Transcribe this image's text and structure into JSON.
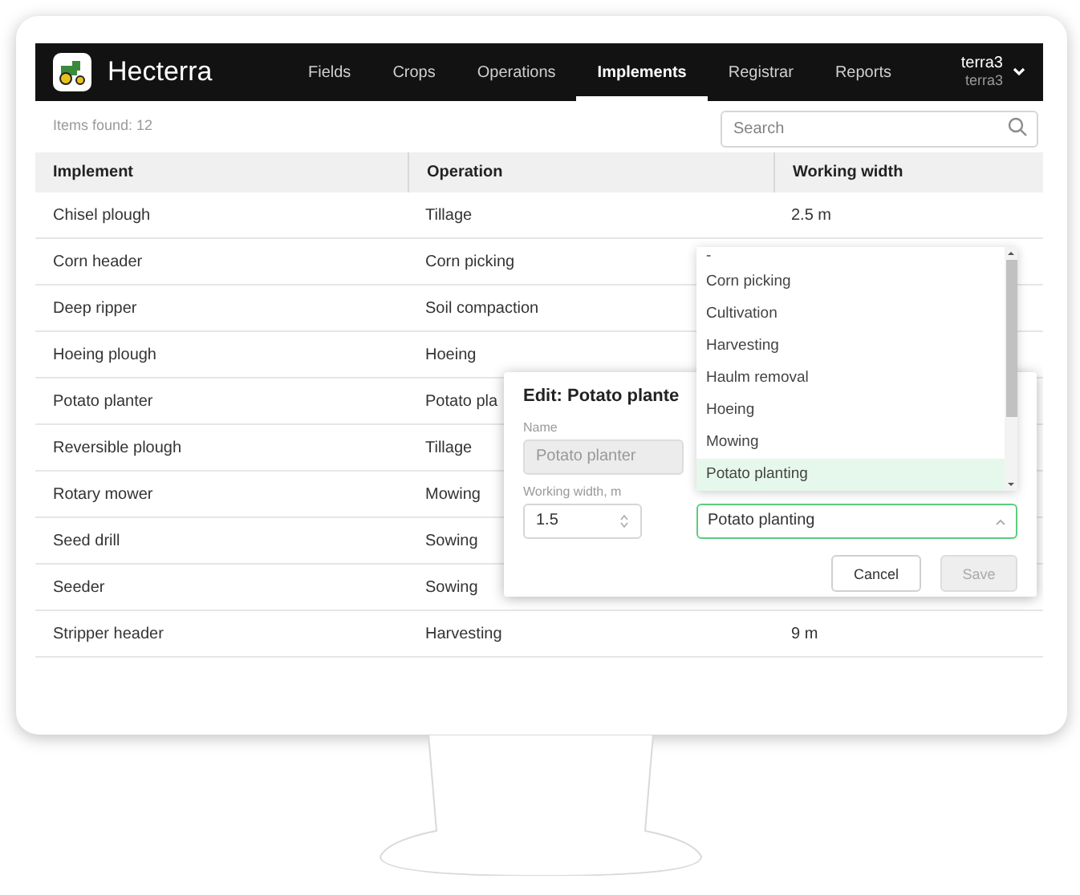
{
  "app": {
    "name": "Hecterra"
  },
  "nav": [
    {
      "label": "Fields",
      "selected": false
    },
    {
      "label": "Crops",
      "selected": false
    },
    {
      "label": "Operations",
      "selected": false
    },
    {
      "label": "Implements",
      "selected": true
    },
    {
      "label": "Registrar",
      "selected": false
    },
    {
      "label": "Reports",
      "selected": false
    }
  ],
  "user": {
    "name": "terra3",
    "login": "terra3"
  },
  "toolbar": {
    "count": "Items found: 12",
    "search": {
      "placeholder": "Search"
    }
  },
  "table": {
    "columns": [
      "Implement",
      "Operation",
      "Working width"
    ],
    "rows": [
      [
        "Chisel plough",
        "Tillage",
        "2.5 m"
      ],
      [
        "Corn header",
        "Corn picking",
        ""
      ],
      [
        "Deep ripper",
        "Soil compaction",
        ""
      ],
      [
        "Hoeing plough",
        "Hoeing",
        ""
      ],
      [
        "Potato planter",
        "Potato pla",
        ""
      ],
      [
        "Reversible plough",
        "Tillage",
        ""
      ],
      [
        "Rotary mower",
        "Mowing",
        ""
      ],
      [
        "Seed drill",
        "Sowing",
        ""
      ],
      [
        "Seeder",
        "Sowing",
        ""
      ],
      [
        "Stripper header",
        "Harvesting",
        "9 m"
      ]
    ]
  },
  "dialog": {
    "title": "Edit: Potato plante",
    "name_label": "Name",
    "name_value": "Potato planter",
    "width_label": "Working width, m",
    "width_value": "1.5",
    "operation_value": "Potato planting",
    "options": [
      {
        "label": "-",
        "selected": false
      },
      {
        "label": "Corn picking",
        "selected": false
      },
      {
        "label": "Cultivation",
        "selected": false
      },
      {
        "label": "Harvesting",
        "selected": false
      },
      {
        "label": "Haulm removal",
        "selected": false
      },
      {
        "label": "Hoeing",
        "selected": false
      },
      {
        "label": "Mowing",
        "selected": false
      },
      {
        "label": "Potato planting",
        "selected": true
      }
    ],
    "buttons": [
      {
        "label": "Cancel",
        "disabled": false
      },
      {
        "label": "Save",
        "disabled": true
      }
    ]
  }
}
